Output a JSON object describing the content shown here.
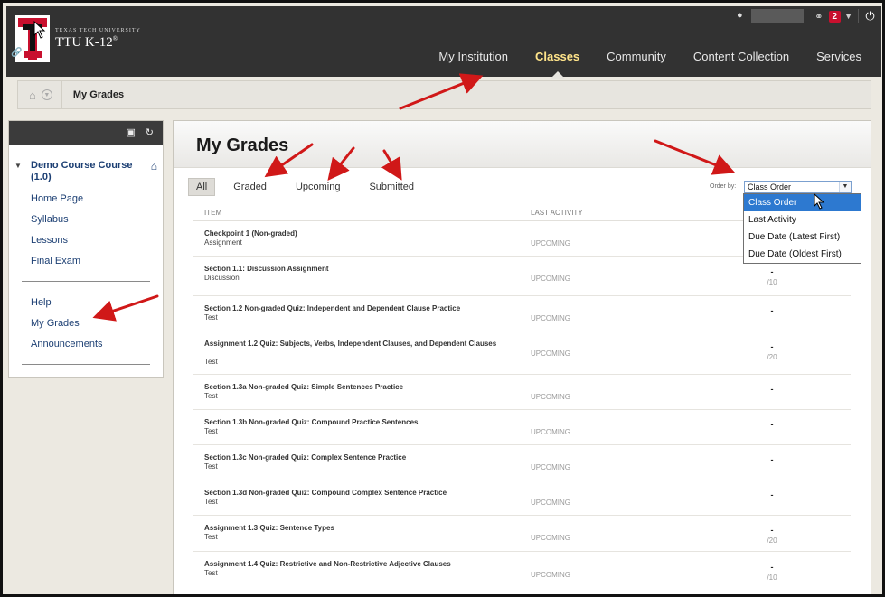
{
  "brand": {
    "small_text": "TEXAS TECH UNIVERSITY",
    "name": "TTU K-12",
    "trademark": "®",
    "logo_letter": "T"
  },
  "topbar": {
    "notification_count": "2"
  },
  "nav": {
    "items": [
      {
        "label": "My Institution",
        "active": false
      },
      {
        "label": "Classes",
        "active": true
      },
      {
        "label": "Community",
        "active": false
      },
      {
        "label": "Content Collection",
        "active": false
      },
      {
        "label": "Services",
        "active": false
      }
    ]
  },
  "breadcrumb": {
    "current": "My Grades"
  },
  "sidebar": {
    "course_title": "Demo Course Course (1.0)",
    "course_links": [
      "Home Page",
      "Syllabus",
      "Lessons",
      "Final Exam"
    ],
    "tool_links": [
      "Help",
      "My Grades",
      "Announcements"
    ]
  },
  "main": {
    "title": "My Grades",
    "filters": [
      "All",
      "Graded",
      "Upcoming",
      "Submitted"
    ],
    "order_by_label": "Order by:",
    "order_by_value": "Class Order",
    "order_options": [
      "Class Order",
      "Last Activity",
      "Due Date (Latest First)",
      "Due Date (Oldest First)"
    ],
    "columns": {
      "item": "ITEM",
      "last_activity": "LAST ACTIVITY"
    },
    "rows": [
      {
        "title": "Checkpoint 1 (Non-graded)",
        "type": "Assignment",
        "status": "UPCOMING",
        "grade": "",
        "points": ""
      },
      {
        "title": "Section 1.1: Discussion Assignment",
        "type": "Discussion",
        "status": "UPCOMING",
        "grade": "-",
        "points": "/10"
      },
      {
        "title": "Section 1.2 Non-graded Quiz: Independent and Dependent Clause Practice",
        "type": "Test",
        "status": "UPCOMING",
        "grade": "-",
        "points": ""
      },
      {
        "title": "Assignment 1.2 Quiz: Subjects, Verbs, Independent Clauses, and Dependent Clauses",
        "type": "Test",
        "status": "UPCOMING",
        "grade": "-",
        "points": "/20"
      },
      {
        "title": "Section 1.3a Non-graded Quiz: Simple Sentences Practice",
        "type": "Test",
        "status": "UPCOMING",
        "grade": "-",
        "points": ""
      },
      {
        "title": "Section 1.3b Non-graded Quiz: Compound Practice Sentences",
        "type": "Test",
        "status": "UPCOMING",
        "grade": "-",
        "points": ""
      },
      {
        "title": "Section 1.3c Non-graded Quiz: Complex Sentence Practice",
        "type": "Test",
        "status": "UPCOMING",
        "grade": "-",
        "points": ""
      },
      {
        "title": "Section 1.3d Non-graded Quiz: Compound Complex Sentence Practice",
        "type": "Test",
        "status": "UPCOMING",
        "grade": "-",
        "points": ""
      },
      {
        "title": "Assignment 1.3 Quiz: Sentence Types",
        "type": "Test",
        "status": "UPCOMING",
        "grade": "-",
        "points": "/20"
      },
      {
        "title": "Assignment 1.4 Quiz: Restrictive and Non-Restrictive Adjective Clauses",
        "type": "Test",
        "status": "UPCOMING",
        "grade": "-",
        "points": "/10"
      }
    ]
  },
  "colors": {
    "header_bg": "#323232",
    "accent_active": "#ffe48a",
    "link": "#1c3f73",
    "annotation_arrow": "#d01818",
    "dropdown_selected": "#2d79d0"
  }
}
